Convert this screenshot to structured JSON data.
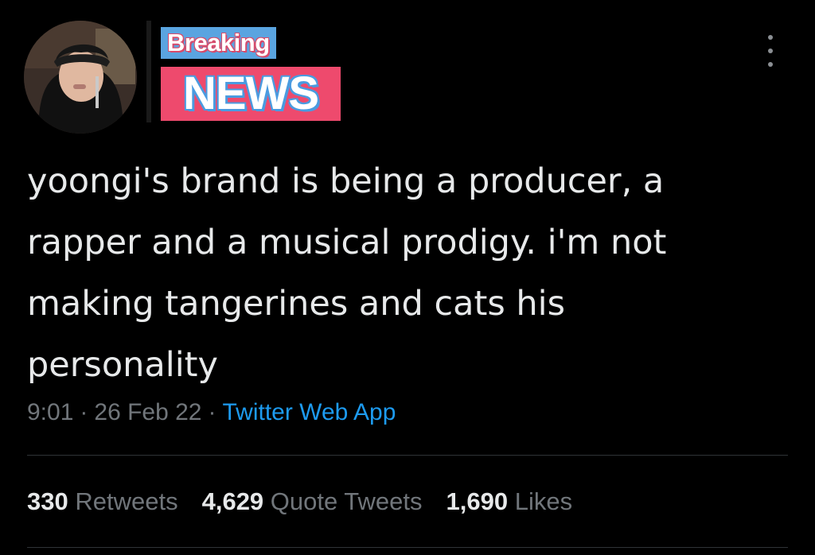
{
  "header": {
    "avatar_icon": "user-avatar-photo",
    "badge": {
      "line1": "Breaking",
      "line2": "NEWS",
      "colors": {
        "line1_bg": "#5aa4e0",
        "line2_bg": "#ee4a6d"
      }
    },
    "more_icon": "more-vertical-icon"
  },
  "tweet": {
    "text": "yoongi's brand is being a producer, a\nrapper and a musical prodigy. i'm not\nmaking tangerines and cats his\npersonality",
    "time": "9:01",
    "date": "26 Feb 22",
    "source": "Twitter Web App",
    "separator": "·"
  },
  "stats": {
    "retweets": {
      "count": "330",
      "label": "Retweets"
    },
    "quote_tweets": {
      "count": "4,629",
      "label": "Quote Tweets"
    },
    "likes": {
      "count": "1,690",
      "label": "Likes"
    }
  },
  "colors": {
    "background": "#000000",
    "text": "#e7e9ea",
    "muted": "#71767b",
    "link": "#1d9bf0"
  }
}
